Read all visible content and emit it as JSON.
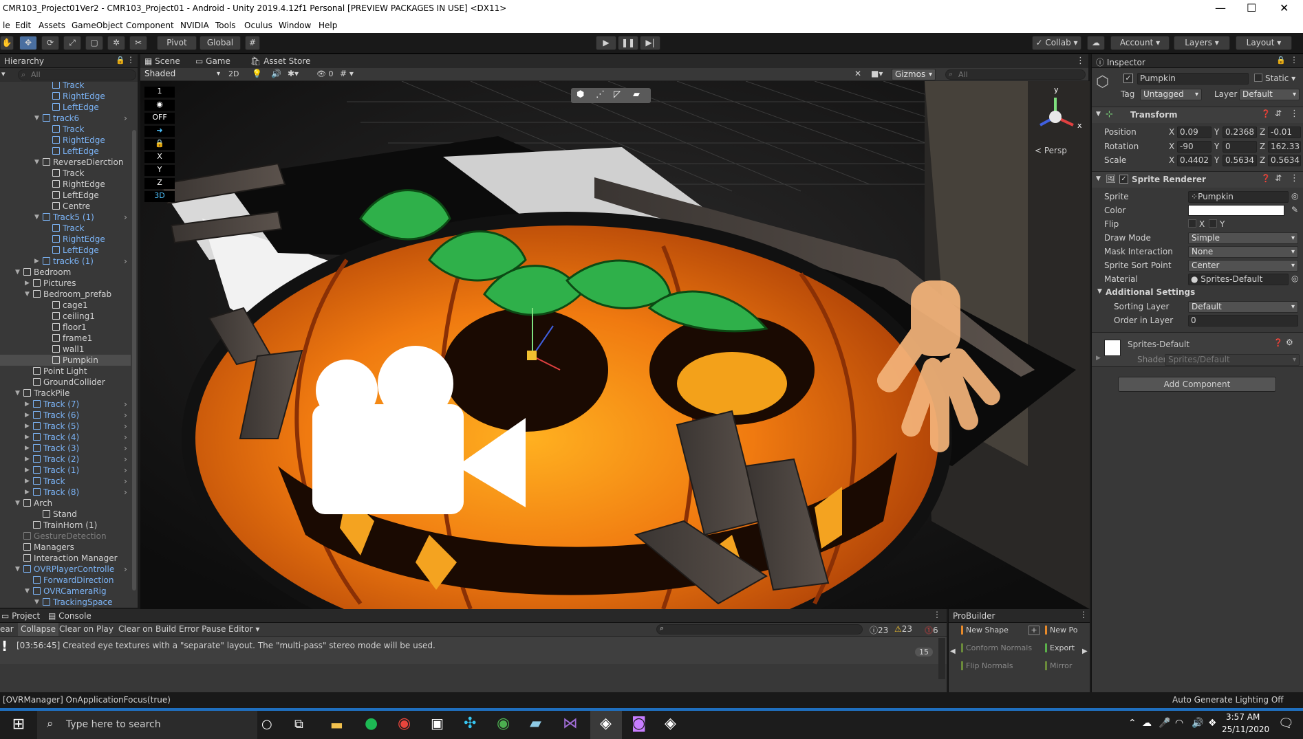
{
  "window": {
    "title": "CMR103_Project01Ver2 - CMR103_Project01 - Android - Unity 2019.4.12f1 Personal [PREVIEW PACKAGES IN USE] <DX11>"
  },
  "menu": [
    "le",
    "Edit",
    "Assets",
    "GameObject",
    "Component",
    "NVIDIA",
    "Tools",
    "Oculus",
    "Window",
    "Help"
  ],
  "toolbar": {
    "pivot": "Pivot",
    "global": "Global",
    "collab": "Collab",
    "account": "Account",
    "layers": "Layers",
    "layout": "Layout"
  },
  "hierarchy": {
    "tab": "Hierarchy",
    "search_placeholder": "All",
    "items": [
      {
        "label": "Track",
        "indent": 7,
        "color": "blue",
        "arrow": ""
      },
      {
        "label": "RightEdge",
        "indent": 7,
        "color": "blue",
        "arrow": ""
      },
      {
        "label": "LeftEdge",
        "indent": 7,
        "color": "blue",
        "arrow": ""
      },
      {
        "label": "track6",
        "indent": 6,
        "color": "blue",
        "arrow": "down",
        "more": true
      },
      {
        "label": "Track",
        "indent": 7,
        "color": "blue",
        "arrow": ""
      },
      {
        "label": "RightEdge",
        "indent": 7,
        "color": "blue",
        "arrow": ""
      },
      {
        "label": "LeftEdge",
        "indent": 7,
        "color": "blue",
        "arrow": ""
      },
      {
        "label": "ReverseDierction",
        "indent": 6,
        "color": "white",
        "arrow": "down"
      },
      {
        "label": "Track",
        "indent": 7,
        "color": "white",
        "arrow": ""
      },
      {
        "label": "RightEdge",
        "indent": 7,
        "color": "white",
        "arrow": ""
      },
      {
        "label": "LeftEdge",
        "indent": 7,
        "color": "white",
        "arrow": ""
      },
      {
        "label": "Centre",
        "indent": 7,
        "color": "white",
        "arrow": ""
      },
      {
        "label": "Track5 (1)",
        "indent": 6,
        "color": "blue",
        "arrow": "down",
        "more": true
      },
      {
        "label": "Track",
        "indent": 7,
        "color": "blue",
        "arrow": ""
      },
      {
        "label": "RightEdge",
        "indent": 7,
        "color": "blue",
        "arrow": ""
      },
      {
        "label": "LeftEdge",
        "indent": 7,
        "color": "blue",
        "arrow": ""
      },
      {
        "label": "track6 (1)",
        "indent": 6,
        "color": "blue",
        "arrow": "right",
        "more": true
      },
      {
        "label": "Bedroom",
        "indent": 4,
        "color": "white",
        "arrow": "down"
      },
      {
        "label": "Pictures",
        "indent": 5,
        "color": "white",
        "arrow": "right"
      },
      {
        "label": "Bedroom_prefab",
        "indent": 5,
        "color": "white",
        "arrow": "down"
      },
      {
        "label": "cage1",
        "indent": 7,
        "color": "white",
        "arrow": ""
      },
      {
        "label": "ceiling1",
        "indent": 7,
        "color": "white",
        "arrow": ""
      },
      {
        "label": "floor1",
        "indent": 7,
        "color": "white",
        "arrow": ""
      },
      {
        "label": "frame1",
        "indent": 7,
        "color": "white",
        "arrow": ""
      },
      {
        "label": "wall1",
        "indent": 7,
        "color": "white",
        "arrow": ""
      },
      {
        "label": "Pumpkin",
        "indent": 7,
        "color": "white",
        "arrow": "",
        "selected": true
      },
      {
        "label": "Point Light",
        "indent": 5,
        "color": "white",
        "arrow": ""
      },
      {
        "label": "GroundCollider",
        "indent": 5,
        "color": "white",
        "arrow": ""
      },
      {
        "label": "TrackPile",
        "indent": 4,
        "color": "white",
        "arrow": "down"
      },
      {
        "label": "Track (7)",
        "indent": 5,
        "color": "blue",
        "arrow": "right",
        "more": true
      },
      {
        "label": "Track (6)",
        "indent": 5,
        "color": "blue",
        "arrow": "right",
        "more": true
      },
      {
        "label": "Track (5)",
        "indent": 5,
        "color": "blue",
        "arrow": "right",
        "more": true
      },
      {
        "label": "Track (4)",
        "indent": 5,
        "color": "blue",
        "arrow": "right",
        "more": true
      },
      {
        "label": "Track (3)",
        "indent": 5,
        "color": "blue",
        "arrow": "right",
        "more": true
      },
      {
        "label": "Track (2)",
        "indent": 5,
        "color": "blue",
        "arrow": "right",
        "more": true
      },
      {
        "label": "Track (1)",
        "indent": 5,
        "color": "blue",
        "arrow": "right",
        "more": true
      },
      {
        "label": "Track",
        "indent": 5,
        "color": "blue",
        "arrow": "right",
        "more": true
      },
      {
        "label": "Track (8)",
        "indent": 5,
        "color": "blue",
        "arrow": "right",
        "more": true
      },
      {
        "label": "Arch",
        "indent": 4,
        "color": "white",
        "arrow": "down"
      },
      {
        "label": "Stand",
        "indent": 6,
        "color": "white",
        "arrow": ""
      },
      {
        "label": "TrainHorn (1)",
        "indent": 5,
        "color": "white",
        "arrow": ""
      },
      {
        "label": "GestureDetection",
        "indent": 4,
        "color": "grey",
        "arrow": ""
      },
      {
        "label": "Managers",
        "indent": 4,
        "color": "white",
        "arrow": ""
      },
      {
        "label": "Interaction Manager",
        "indent": 4,
        "color": "white",
        "arrow": ""
      },
      {
        "label": "OVRPlayerControlle",
        "indent": 4,
        "color": "blue",
        "arrow": "down",
        "more": true
      },
      {
        "label": "ForwardDirection",
        "indent": 5,
        "color": "blue",
        "arrow": ""
      },
      {
        "label": "OVRCameraRig",
        "indent": 5,
        "color": "blue",
        "arrow": "down"
      },
      {
        "label": "TrackingSpace",
        "indent": 6,
        "color": "blue",
        "arrow": "down"
      }
    ]
  },
  "scene": {
    "tabs": [
      "Scene",
      "Game",
      "Asset Store"
    ],
    "shading": "Shaded",
    "mode2d": "2D",
    "fx_count": "0",
    "gizmos": "Gizmos",
    "search_placeholder": "All",
    "persp": "< Persp",
    "overlay": [
      "1",
      "OFF",
      "X",
      "Y",
      "Z",
      "3D"
    ],
    "axis_x": "x",
    "axis_y": "y"
  },
  "inspector": {
    "tab": "Inspector",
    "object_name": "Pumpkin",
    "static": "Static",
    "tag_label": "Tag",
    "tag": "Untagged",
    "layer_label": "Layer",
    "layer": "Default",
    "transform": {
      "title": "Transform",
      "position_label": "Position",
      "rotation_label": "Rotation",
      "scale_label": "Scale",
      "position": {
        "x": "0.09",
        "y": "0.2368",
        "z": "-0.01"
      },
      "rotation": {
        "x": "-90",
        "y": "0",
        "z": "162.336"
      },
      "scale": {
        "x": "0.4402",
        "y": "0.5634",
        "z": "0.5634"
      }
    },
    "sprite_renderer": {
      "title": "Sprite Renderer",
      "sprite_label": "Sprite",
      "sprite": "Pumpkin",
      "color_label": "Color",
      "flip_label": "Flip",
      "flip_x": "X",
      "flip_y": "Y",
      "draw_mode_label": "Draw Mode",
      "draw_mode": "Simple",
      "mask_label": "Mask Interaction",
      "mask": "None",
      "sort_point_label": "Sprite Sort Point",
      "sort_point": "Center",
      "material_label": "Material",
      "material": "Sprites-Default",
      "additional": "Additional Settings",
      "sorting_layer_label": "Sorting Layer",
      "sorting_layer": "Default",
      "order_label": "Order in Layer",
      "order": "0"
    },
    "material_block": {
      "name": "Sprites-Default",
      "shader_label": "Shader",
      "shader": "Sprites/Default"
    },
    "add_component": "Add Component"
  },
  "console": {
    "tabs": [
      "Project",
      "Console"
    ],
    "buttons": [
      "ear",
      "Collapse",
      "Clear on Play",
      "Clear on Build",
      "Error Pause",
      "Editor"
    ],
    "counts": {
      "info": "23",
      "warn": "23",
      "error": "6"
    },
    "message": "[03:56:45] Created eye textures with a \"separate\" layout.  The \"multi-pass\" stereo mode will be used.",
    "message_count": "15"
  },
  "probuilder": {
    "tab": "ProBuilder",
    "items": [
      "New Shape",
      "New Po",
      "Conform Normals",
      "Export",
      "Flip Normals",
      "Mirror"
    ]
  },
  "status": {
    "left": "[OVRManager] OnApplicationFocus(true)",
    "right": "Auto Generate Lighting Off"
  },
  "taskbar": {
    "search_placeholder": "Type here to search",
    "time": "3:57 AM",
    "date": "25/11/2020"
  },
  "colors": {
    "accent": "#3a72b0",
    "blue_text": "#7bb3f5",
    "pumpkin": "#e8731a",
    "leaf": "#2fb04a"
  }
}
